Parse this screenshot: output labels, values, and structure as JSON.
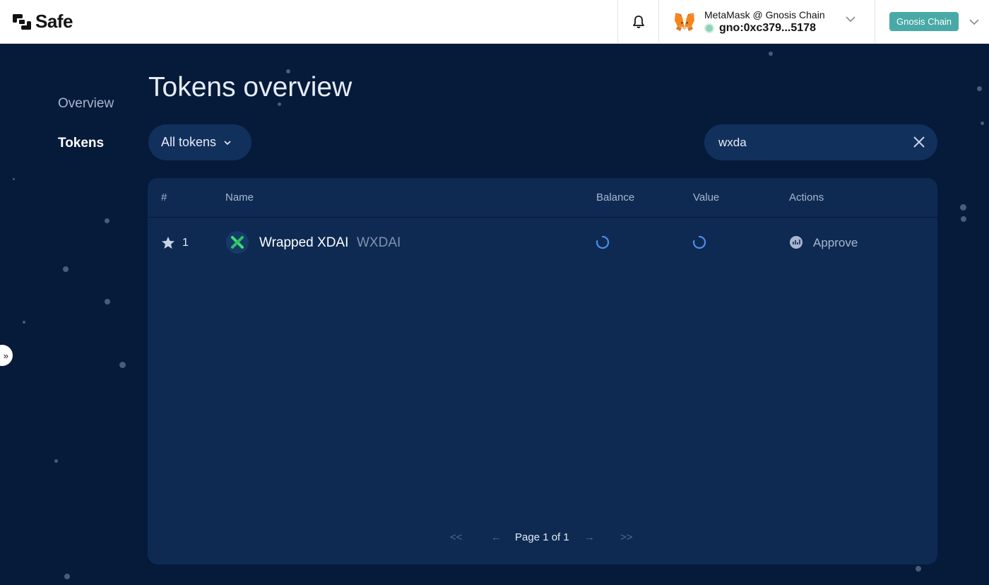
{
  "header": {
    "logo_text": "Safe",
    "wallet": {
      "name": "MetaMask @ Gnosis Chain",
      "address": "gno:0xc379...5178"
    },
    "network": "Gnosis Chain"
  },
  "sidebar": {
    "items": [
      {
        "label": "Overview",
        "active": false
      },
      {
        "label": "Tokens",
        "active": true
      }
    ]
  },
  "main": {
    "title": "Tokens overview",
    "filter_label": "All tokens",
    "search": {
      "value": "wxda"
    },
    "table": {
      "columns": [
        "#",
        "Name",
        "Balance",
        "Value",
        "Actions"
      ],
      "rows": [
        {
          "rank": "1",
          "name": "Wrapped XDAI",
          "symbol": "WXDAI",
          "action": "Approve"
        }
      ]
    },
    "pagination": {
      "first": "<<",
      "prev": "←",
      "label": "Page 1 of 1",
      "next": "→",
      "last": ">>"
    }
  },
  "colors": {
    "background": "#061a3a",
    "card": "#0e2a52",
    "network_badge": "#48a9a6",
    "spinner": "#4a8de6"
  }
}
